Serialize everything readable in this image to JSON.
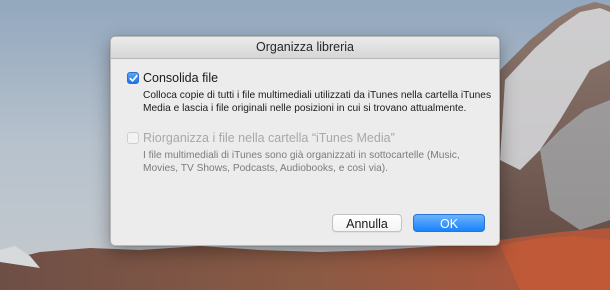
{
  "dialog": {
    "title": "Organizza libreria"
  },
  "option_consolidate": {
    "checked": true,
    "label": "Consolida file",
    "description": "Colloca copie di tutti i file multimediali utilizzati da iTunes nella cartella iTunes Media e lascia i file originali nelle posizioni in cui si trovano attualmente."
  },
  "option_reorganize": {
    "checked": false,
    "disabled": true,
    "label": "Riorganizza i file nella cartella “iTunes Media”",
    "description": "I file multimediali di iTunes sono già organizzati in sottocartelle (Music, Movies, TV Shows, Podcasts, Audiobooks, e così via)."
  },
  "buttons": {
    "cancel_label": "Annulla",
    "ok_label": "OK"
  },
  "icons": {
    "checkmark": "checkmark-icon"
  },
  "colors": {
    "accent": "#1a82fb",
    "dialog_background": "#ececec",
    "disabled_text": "#a8a8a8"
  }
}
